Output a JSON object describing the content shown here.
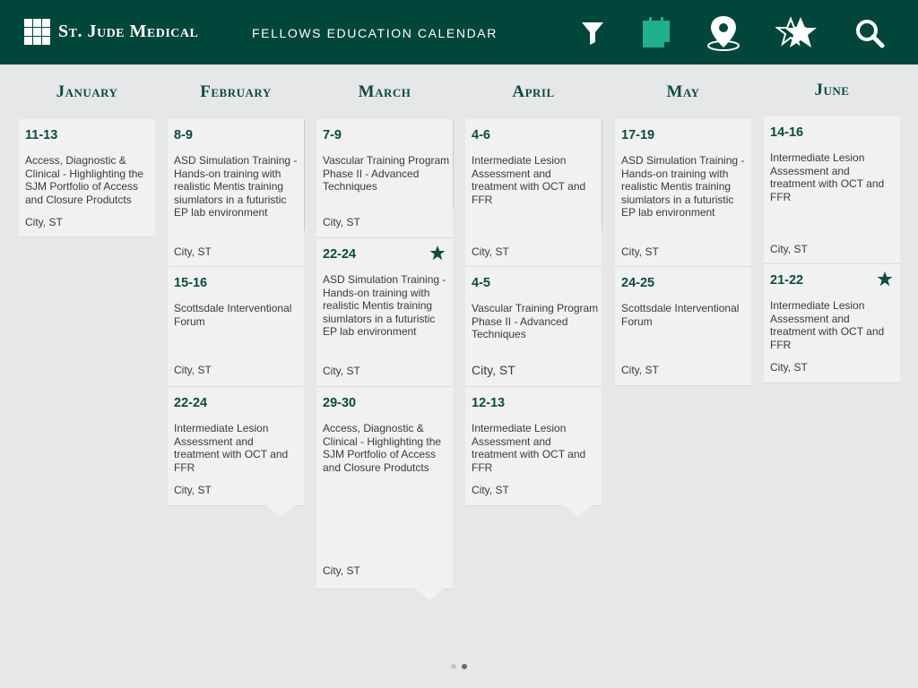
{
  "header": {
    "brand": "St. Jude Medical",
    "title": "FELLOWS EDUCATION CALENDAR",
    "icons": [
      "filter-icon",
      "calendar-icon",
      "location-pin-icon",
      "favorites-star-icon",
      "search-icon"
    ],
    "color": "#00463a"
  },
  "months": [
    "January",
    "February",
    "March",
    "April",
    "May",
    "June"
  ],
  "columns": [
    {
      "events": [
        {
          "date": "11-13",
          "desc": "Access, Diagnostic & Clinical - Highlighting the SJM Portfolio of Access and Closure Produtcts",
          "loc": "City, ST"
        }
      ]
    },
    {
      "events": [
        {
          "date": "8-9",
          "desc": "ASD Simulation Training - Hands-on training with realistic Mentis training siumlators in a futuristic EP lab environment",
          "loc": "City, ST"
        },
        {
          "date": "15-16",
          "desc": "Scottsdale Interventional Forum",
          "loc": "City, ST"
        },
        {
          "date": "22-24",
          "desc": "Intermediate Lesion Assessment and treatment with OCT and FFR",
          "loc": "City, ST"
        }
      ]
    },
    {
      "events": [
        {
          "date": "7-9",
          "desc": "Vascular Training Program Phase II - Advanced Techniques",
          "loc": "City, ST"
        },
        {
          "date": "22-24",
          "desc": "ASD Simulation Training - Hands-on training with realistic Mentis training siumlators in a futuristic EP lab environment",
          "loc": "City, ST",
          "starred": true
        },
        {
          "date": "29-30",
          "desc": "Access, Diagnostic & Clinical - Highlighting the SJM Portfolio of Access and Closure Produtcts",
          "loc": "City, ST"
        }
      ]
    },
    {
      "events": [
        {
          "date": "4-6",
          "desc": "Intermediate Lesion Assessment and treatment with OCT and FFR",
          "loc": "City, ST"
        },
        {
          "date": "4-5",
          "desc": "Vascular Training Program Phase II - Advanced Techniques",
          "loc": "City, ST"
        },
        {
          "date": "12-13",
          "desc": "Intermediate Lesion Assessment and treatment with OCT and FFR",
          "loc": "City, ST"
        }
      ]
    },
    {
      "events": [
        {
          "date": "17-19",
          "desc": "ASD Simulation Training - Hands-on training with realistic Mentis training siumlators in a futuristic EP lab environment",
          "loc": "City, ST"
        },
        {
          "date": "24-25",
          "desc": "Scottsdale Interventional Forum",
          "loc": "City, ST"
        }
      ]
    },
    {
      "events": [
        {
          "date": "14-16",
          "desc": "Intermediate Lesion Assessment and treatment with OCT and FFR",
          "loc": "City, ST"
        },
        {
          "date": "21-22",
          "desc": "Intermediate Lesion Assessment and treatment with OCT and FFR",
          "loc": "City, ST",
          "starred": true
        }
      ]
    }
  ],
  "pager": {
    "pages": 2,
    "current": 2
  }
}
